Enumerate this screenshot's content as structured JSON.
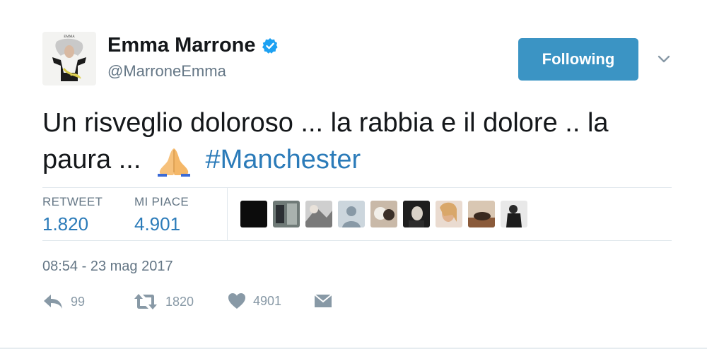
{
  "user": {
    "display_name": "Emma Marrone",
    "handle": "@MarroneEmma",
    "avatar_caption": "EMMA",
    "verified": true
  },
  "follow_button": {
    "label": "Following",
    "color": "#3b94c4"
  },
  "tweet": {
    "text_before": "Un risveglio doloroso ... la rabbia e il dolore .. la paura ...",
    "emoji": "folded-hands",
    "hashtag": "#Manchester"
  },
  "stats": {
    "retweets": {
      "label": "RETWEET",
      "value": "1.820"
    },
    "likes": {
      "label": "MI PIACE",
      "value": "4.901"
    }
  },
  "likers_count_shown": 9,
  "timestamp": "08:54 - 23 mag 2017",
  "actions": {
    "reply_count": "99",
    "retweet_count": "1820",
    "like_count": "4901"
  },
  "colors": {
    "link": "#2b7bb9",
    "muted": "#657786",
    "action_grey": "#8899a6",
    "divider": "#e1e8ed"
  }
}
